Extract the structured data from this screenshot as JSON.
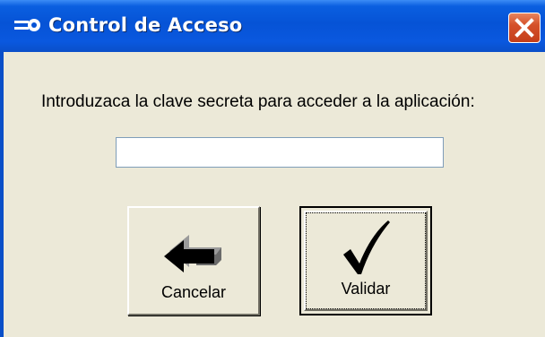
{
  "window": {
    "title": "Control de Acceso",
    "title_icon": "key-icon",
    "close_icon": "close-icon"
  },
  "dialog": {
    "prompt": "Introduzaca la clave secreta para acceder a la aplicación:",
    "password": {
      "value": "",
      "placeholder": ""
    }
  },
  "buttons": {
    "cancel": {
      "label": "Cancelar",
      "icon": "arrow-left-icon"
    },
    "validate": {
      "label": "Validar",
      "icon": "checkmark-icon"
    }
  },
  "colors": {
    "titlebar": "#0653d6",
    "face": "#ece9d8",
    "close": "#d5512a"
  }
}
